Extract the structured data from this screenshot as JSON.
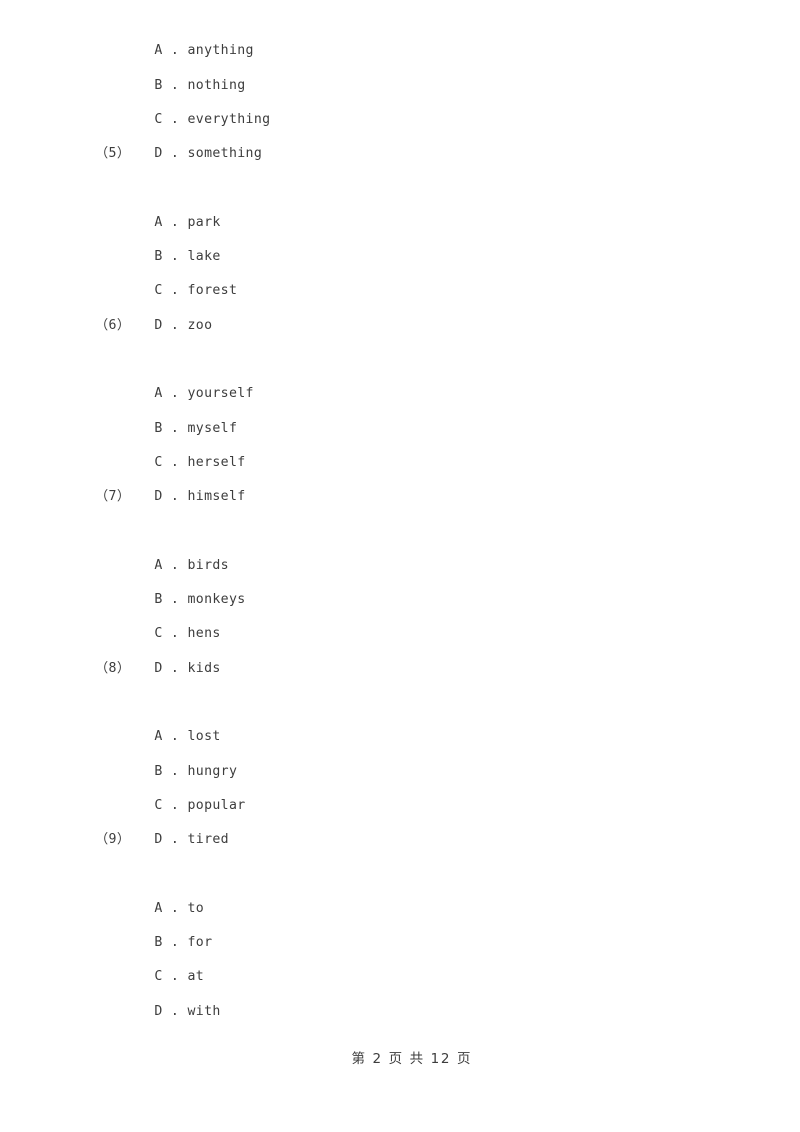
{
  "document": {
    "page_background": "#ffffff",
    "text_color": "#3d3d3d",
    "footer": {
      "prefix": "第",
      "current_page": "2",
      "middle": "页 共",
      "total_pages": "12",
      "suffix": "页",
      "full_text": "第 2 页 共 12 页"
    }
  },
  "blocks": [
    {
      "id": "question-4-options",
      "question_label": "",
      "options": [
        {
          "letter": "A",
          "separator": ".",
          "text": "anything"
        },
        {
          "letter": "B",
          "separator": ".",
          "text": "nothing"
        },
        {
          "letter": "C",
          "separator": ".",
          "text": "everything"
        },
        {
          "letter": "D",
          "separator": ".",
          "text": "something"
        }
      ]
    },
    {
      "id": "question-5",
      "question_label": "（5）",
      "options": [
        {
          "letter": "A",
          "separator": ".",
          "text": "park"
        },
        {
          "letter": "B",
          "separator": ".",
          "text": "lake"
        },
        {
          "letter": "C",
          "separator": ".",
          "text": "forest"
        },
        {
          "letter": "D",
          "separator": ".",
          "text": "zoo"
        }
      ]
    },
    {
      "id": "question-6",
      "question_label": "（6）",
      "options": [
        {
          "letter": "A",
          "separator": ".",
          "text": "yourself"
        },
        {
          "letter": "B",
          "separator": ".",
          "text": "myself"
        },
        {
          "letter": "C",
          "separator": ".",
          "text": "herself"
        },
        {
          "letter": "D",
          "separator": ".",
          "text": "himself"
        }
      ]
    },
    {
      "id": "question-7",
      "question_label": "（7）",
      "options": [
        {
          "letter": "A",
          "separator": ".",
          "text": "birds"
        },
        {
          "letter": "B",
          "separator": ".",
          "text": "monkeys"
        },
        {
          "letter": "C",
          "separator": ".",
          "text": "hens"
        },
        {
          "letter": "D",
          "separator": ".",
          "text": "kids"
        }
      ]
    },
    {
      "id": "question-8",
      "question_label": "（8）",
      "options": [
        {
          "letter": "A",
          "separator": ".",
          "text": "lost"
        },
        {
          "letter": "B",
          "separator": ".",
          "text": "hungry"
        },
        {
          "letter": "C",
          "separator": ".",
          "text": "popular"
        },
        {
          "letter": "D",
          "separator": ".",
          "text": "tired"
        }
      ]
    },
    {
      "id": "question-9",
      "question_label": "（9）",
      "options": [
        {
          "letter": "A",
          "separator": ".",
          "text": "to"
        },
        {
          "letter": "B",
          "separator": ".",
          "text": "for"
        },
        {
          "letter": "C",
          "separator": ".",
          "text": "at"
        },
        {
          "letter": "D",
          "separator": ".",
          "text": "with"
        }
      ]
    }
  ]
}
